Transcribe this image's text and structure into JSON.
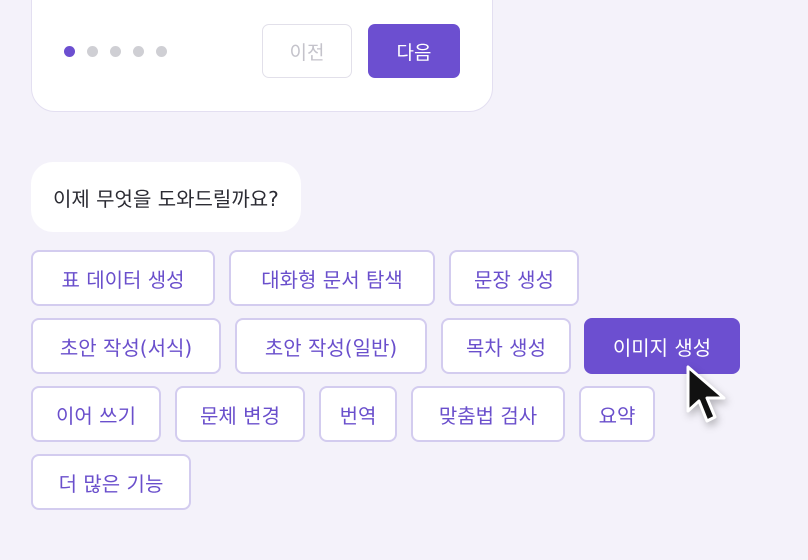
{
  "onboarding": {
    "steps_total": 5,
    "current_step": 1,
    "prev_label": "이전",
    "next_label": "다음"
  },
  "assistant": {
    "prompt": "이제 무엇을 도와드릴까요?"
  },
  "actions": [
    {
      "label": "표 데이터 생성"
    },
    {
      "label": "대화형 문서 탐색"
    },
    {
      "label": "문장 생성"
    },
    {
      "label": "초안 작성(서식)"
    },
    {
      "label": "초안 작성(일반)"
    },
    {
      "label": "목차 생성"
    },
    {
      "label": "이미지 생성",
      "active": true
    },
    {
      "label": "이어 쓰기"
    },
    {
      "label": "문체 변경"
    },
    {
      "label": "번역"
    },
    {
      "label": "맞춤법 검사"
    },
    {
      "label": "요약"
    },
    {
      "label": "더 많은 기능"
    }
  ],
  "icons": {
    "cursor": "arrow-cursor-icon"
  },
  "colors": {
    "accent": "#6c4fd0",
    "chip_border": "#d3ccef",
    "background": "#f4f2fa"
  }
}
